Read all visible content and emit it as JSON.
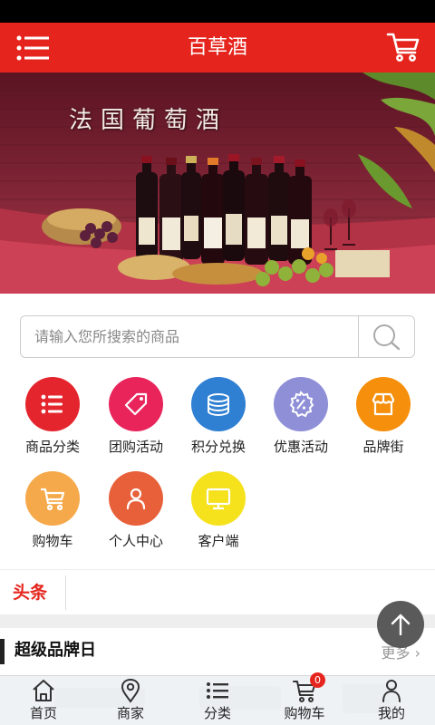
{
  "app": {
    "title": "百草酒"
  },
  "banner": {
    "title": "法国葡萄酒"
  },
  "search": {
    "placeholder": "请输入您所搜索的商品",
    "value": ""
  },
  "quick_links": [
    {
      "label": "商品分类",
      "color": "#e5252d",
      "icon": "list-icon"
    },
    {
      "label": "团购活动",
      "color": "#e8245b",
      "icon": "tag-icon"
    },
    {
      "label": "积分兑换",
      "color": "#2f7fd3",
      "icon": "coins-icon"
    },
    {
      "label": "优惠活动",
      "color": "#8f8fd8",
      "icon": "percent-icon"
    },
    {
      "label": "品牌街",
      "color": "#f58f0c",
      "icon": "shop-icon"
    },
    {
      "label": "购物车",
      "color": "#f5a94a",
      "icon": "cart-icon"
    },
    {
      "label": "个人中心",
      "color": "#e8603a",
      "icon": "user-icon"
    },
    {
      "label": "客户端",
      "color": "#f5e11c",
      "icon": "monitor-icon"
    }
  ],
  "headline": {
    "tag": "头条"
  },
  "section": {
    "title": "超级品牌日",
    "more": "更多"
  },
  "tabbar": [
    {
      "label": "首页",
      "icon": "home-icon"
    },
    {
      "label": "商家",
      "icon": "location-pin-icon"
    },
    {
      "label": "分类",
      "icon": "list-icon"
    },
    {
      "label": "购物车",
      "icon": "cart-icon",
      "badge": "0"
    },
    {
      "label": "我的",
      "icon": "user-icon"
    }
  ],
  "colors": {
    "brand_red": "#e5251d",
    "back_to_top": "#5a5a5a"
  }
}
